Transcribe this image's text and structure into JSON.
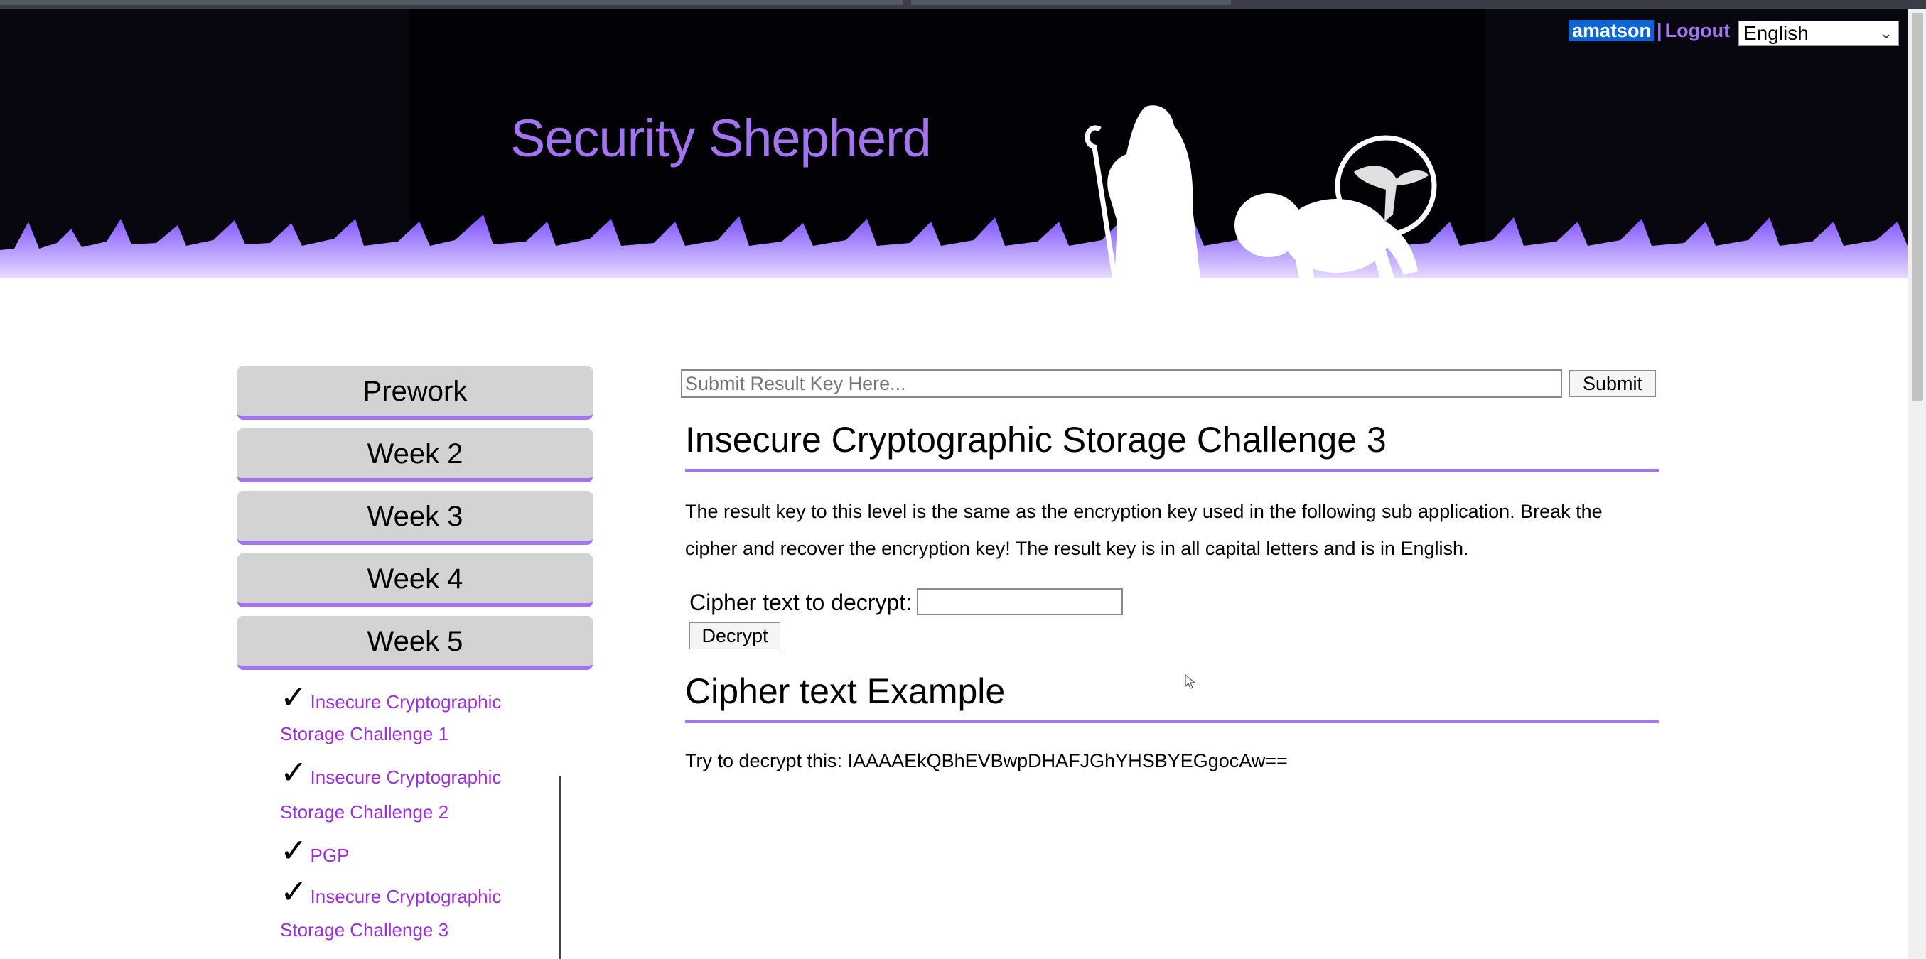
{
  "header": {
    "title": "Security Shepherd",
    "username": "amatson",
    "separator": "|",
    "logout_label": "Logout",
    "language": "English"
  },
  "nav": {
    "buttons": [
      {
        "label": "Prework"
      },
      {
        "label": "Week 2"
      },
      {
        "label": "Week 3"
      },
      {
        "label": "Week 4"
      },
      {
        "label": "Week 5"
      }
    ],
    "submodules": [
      {
        "line1": "Insecure Cryptographic",
        "line2": "Storage Challenge 1",
        "done": true
      },
      {
        "line1": "Insecure Cryptographic",
        "line2": "Storage Challenge 2",
        "done": true
      },
      {
        "line1": "PGP",
        "line2": "",
        "done": true
      },
      {
        "line1": "Insecure Cryptographic",
        "line2": "Storage Challenge 3",
        "done": true
      }
    ],
    "check_glyph": "✓"
  },
  "submit": {
    "placeholder": "Submit Result Key Here...",
    "button_label": "Submit"
  },
  "challenge": {
    "title": "Insecure Cryptographic Storage Challenge 3",
    "description": "The result key to this level is the same as the encryption key used in the following sub application. Break the cipher and recover the encryption key! The result key is in all capital letters and is in English.",
    "cipher_label": "Cipher text to decrypt:",
    "decrypt_label": "Decrypt",
    "example_title": "Cipher text Example",
    "example_text": "Try to decrypt this: IAAAAEkQBhEVBwpDHAFJGhYHSBYEGgocAw=="
  },
  "colors": {
    "accent": "#a374f0",
    "link": "#9b30d9",
    "banner": "#020106"
  }
}
